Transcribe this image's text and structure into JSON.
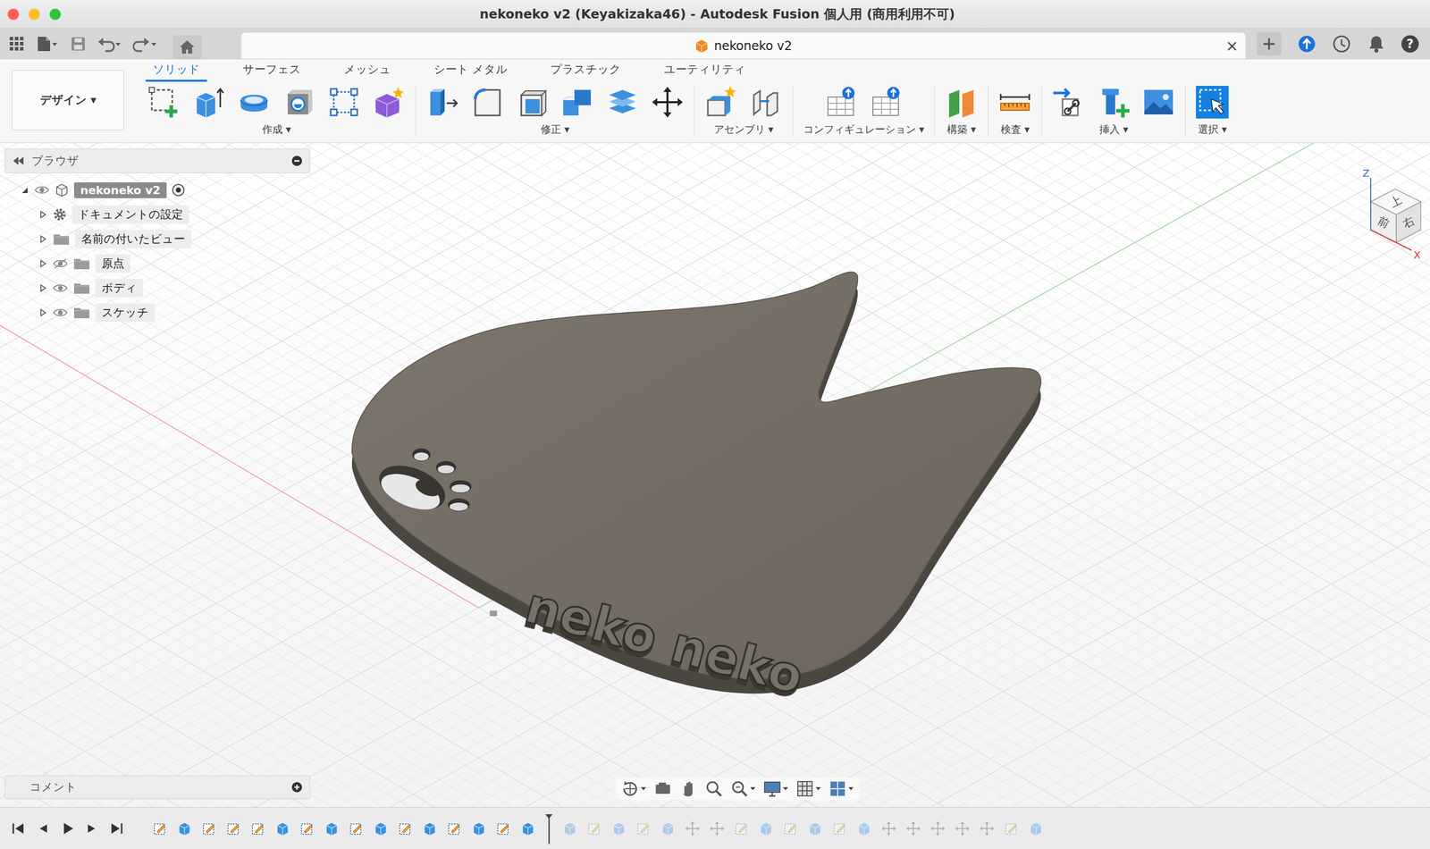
{
  "window": {
    "title": "nekoneko v2 (Keyakizaka46) - Autodesk Fusion 個人用 (商用利用不可)"
  },
  "document_tab": {
    "label": "nekoneko v2",
    "close": "×",
    "selected": true
  },
  "help": {
    "label": "?"
  },
  "workspace": {
    "label": "デザイン ▾"
  },
  "toolbar_tabs": [
    {
      "label": "ソリッド",
      "selected": true
    },
    {
      "label": "サーフェス",
      "selected": false
    },
    {
      "label": "メッシュ",
      "selected": false
    },
    {
      "label": "シート メタル",
      "selected": false
    },
    {
      "label": "プラスチック",
      "selected": false
    },
    {
      "label": "ユーティリティ",
      "selected": false
    }
  ],
  "tool_groups": [
    {
      "label": "作成 ▾",
      "selected": false
    },
    {
      "label": "修正 ▾",
      "selected": false
    },
    {
      "label": "アセンブリ ▾",
      "selected": false
    },
    {
      "label": "コンフィギュレーション ▾",
      "selected": false
    },
    {
      "label": "構築 ▾",
      "selected": false
    },
    {
      "label": "検査 ▾",
      "selected": false
    },
    {
      "label": "挿入 ▾",
      "selected": false
    },
    {
      "label": "選択 ▾",
      "selected": true
    }
  ],
  "browser": {
    "title": "ブラウザ",
    "items": [
      {
        "label": "nekoneko v2",
        "kind": "root",
        "expanded": true,
        "visible": true,
        "active": true
      },
      {
        "label": "ドキュメントの設定",
        "kind": "settings",
        "expanded": false
      },
      {
        "label": "名前の付いたビュー",
        "kind": "views",
        "expanded": false
      },
      {
        "label": "原点",
        "kind": "folder",
        "expanded": false,
        "visible": false
      },
      {
        "label": "ボディ",
        "kind": "folder",
        "expanded": false,
        "visible": true
      },
      {
        "label": "スケッチ",
        "kind": "folder",
        "expanded": false,
        "visible": true
      }
    ]
  },
  "comments": {
    "label": "コメント"
  },
  "viewcube": {
    "faces": [
      {
        "label": "上"
      },
      {
        "label": "前"
      },
      {
        "label": "右"
      }
    ],
    "axes": [
      {
        "label": "Z",
        "color": "#3a6fd8"
      },
      {
        "label": "X",
        "color": "#d23b3b"
      }
    ]
  },
  "model": {
    "engraving": "neko neko"
  },
  "timeline": {
    "features": [
      {
        "kind": "sketch",
        "rolled_back": false
      },
      {
        "kind": "extrude",
        "rolled_back": false
      },
      {
        "kind": "sketch",
        "rolled_back": false
      },
      {
        "kind": "sketch",
        "rolled_back": false
      },
      {
        "kind": "sketch",
        "rolled_back": false
      },
      {
        "kind": "extrude",
        "rolled_back": false
      },
      {
        "kind": "sketch",
        "rolled_back": false
      },
      {
        "kind": "extrude",
        "rolled_back": false
      },
      {
        "kind": "sketch",
        "rolled_back": false
      },
      {
        "kind": "extrude",
        "rolled_back": false
      },
      {
        "kind": "sketch",
        "rolled_back": false
      },
      {
        "kind": "extrude",
        "rolled_back": false
      },
      {
        "kind": "sketch",
        "rolled_back": false
      },
      {
        "kind": "extrude",
        "rolled_back": false
      },
      {
        "kind": "sketch",
        "rolled_back": false
      },
      {
        "kind": "extrude",
        "rolled_back": false
      },
      {
        "kind": "extrude",
        "rolled_back": true
      },
      {
        "kind": "sketch",
        "rolled_back": true
      },
      {
        "kind": "extrude",
        "rolled_back": true
      },
      {
        "kind": "sketch",
        "rolled_back": true
      },
      {
        "kind": "extrude",
        "rolled_back": true
      },
      {
        "kind": "move",
        "rolled_back": true
      },
      {
        "kind": "move",
        "rolled_back": true
      },
      {
        "kind": "sketch",
        "rolled_back": true
      },
      {
        "kind": "extrude",
        "rolled_back": true
      },
      {
        "kind": "sketch",
        "rolled_back": true
      },
      {
        "kind": "extrude",
        "rolled_back": true
      },
      {
        "kind": "sketch",
        "rolled_back": true
      },
      {
        "kind": "extrude",
        "rolled_back": true
      },
      {
        "kind": "move",
        "rolled_back": true
      },
      {
        "kind": "move",
        "rolled_back": true
      },
      {
        "kind": "move",
        "rolled_back": true
      },
      {
        "kind": "move",
        "rolled_back": true
      },
      {
        "kind": "move",
        "rolled_back": true
      },
      {
        "kind": "sketch",
        "rolled_back": true
      },
      {
        "kind": "extrude",
        "rolled_back": true
      }
    ]
  }
}
